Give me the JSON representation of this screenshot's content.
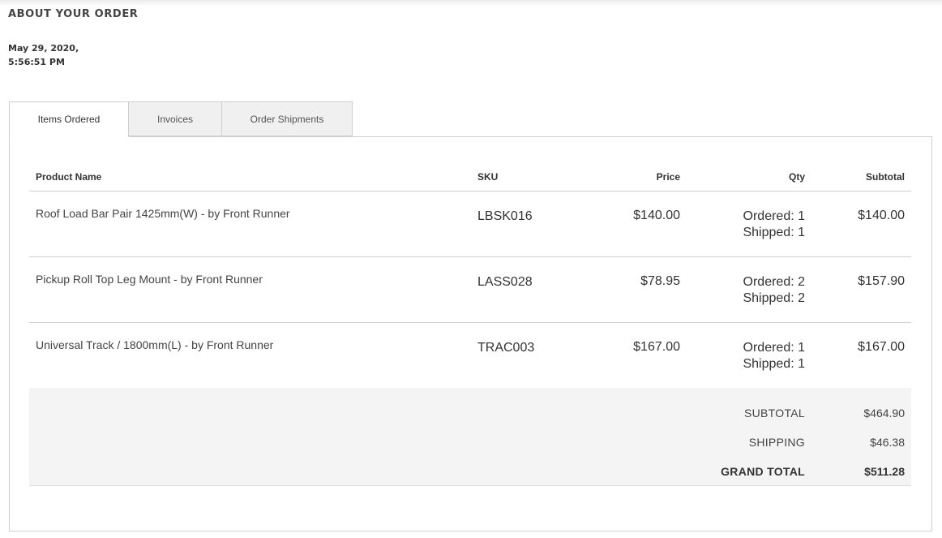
{
  "page": {
    "heading": "ABOUT YOUR ORDER",
    "date_line1": "May 29, 2020,",
    "date_line2": "5:56:51 PM"
  },
  "tabs": [
    {
      "label": "Items Ordered",
      "active": true
    },
    {
      "label": "Invoices",
      "active": false
    },
    {
      "label": "Order Shipments",
      "active": false
    }
  ],
  "table": {
    "headers": {
      "product": "Product Name",
      "sku": "SKU",
      "price": "Price",
      "qty": "Qty",
      "subtotal": "Subtotal"
    },
    "rows": [
      {
        "name": "Roof Load Bar Pair 1425mm(W) - by Front Runner",
        "sku": "LBSK016",
        "price": "$140.00",
        "ordered": "Ordered: 1",
        "shipped": "Shipped: 1",
        "subtotal": "$140.00"
      },
      {
        "name": "Pickup Roll Top Leg Mount - by Front Runner",
        "sku": "LASS028",
        "price": "$78.95",
        "ordered": "Ordered: 2",
        "shipped": "Shipped: 2",
        "subtotal": "$157.90"
      },
      {
        "name": "Universal Track / 1800mm(L) - by Front Runner",
        "sku": "TRAC003",
        "price": "$167.00",
        "ordered": "Ordered: 1",
        "shipped": "Shipped: 1",
        "subtotal": "$167.00"
      }
    ]
  },
  "totals": {
    "subtotal_label": "SUBTOTAL",
    "subtotal_value": "$464.90",
    "shipping_label": "SHIPPING",
    "shipping_value": "$46.38",
    "grand_label": "GRAND TOTAL",
    "grand_value": "$511.28"
  }
}
